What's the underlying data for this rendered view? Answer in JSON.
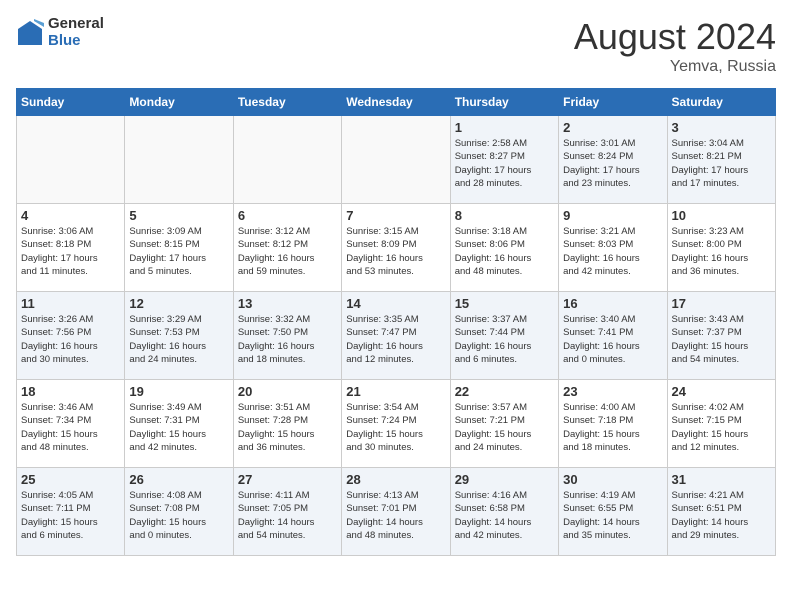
{
  "header": {
    "logo_general": "General",
    "logo_blue": "Blue",
    "month_year": "August 2024",
    "location": "Yemva, Russia"
  },
  "weekdays": [
    "Sunday",
    "Monday",
    "Tuesday",
    "Wednesday",
    "Thursday",
    "Friday",
    "Saturday"
  ],
  "weeks": [
    [
      {
        "day": "",
        "info": "",
        "empty": true
      },
      {
        "day": "",
        "info": "",
        "empty": true
      },
      {
        "day": "",
        "info": "",
        "empty": true
      },
      {
        "day": "",
        "info": "",
        "empty": true
      },
      {
        "day": "1",
        "info": "Sunrise: 2:58 AM\nSunset: 8:27 PM\nDaylight: 17 hours\nand 28 minutes."
      },
      {
        "day": "2",
        "info": "Sunrise: 3:01 AM\nSunset: 8:24 PM\nDaylight: 17 hours\nand 23 minutes."
      },
      {
        "day": "3",
        "info": "Sunrise: 3:04 AM\nSunset: 8:21 PM\nDaylight: 17 hours\nand 17 minutes."
      }
    ],
    [
      {
        "day": "4",
        "info": "Sunrise: 3:06 AM\nSunset: 8:18 PM\nDaylight: 17 hours\nand 11 minutes."
      },
      {
        "day": "5",
        "info": "Sunrise: 3:09 AM\nSunset: 8:15 PM\nDaylight: 17 hours\nand 5 minutes."
      },
      {
        "day": "6",
        "info": "Sunrise: 3:12 AM\nSunset: 8:12 PM\nDaylight: 16 hours\nand 59 minutes."
      },
      {
        "day": "7",
        "info": "Sunrise: 3:15 AM\nSunset: 8:09 PM\nDaylight: 16 hours\nand 53 minutes."
      },
      {
        "day": "8",
        "info": "Sunrise: 3:18 AM\nSunset: 8:06 PM\nDaylight: 16 hours\nand 48 minutes."
      },
      {
        "day": "9",
        "info": "Sunrise: 3:21 AM\nSunset: 8:03 PM\nDaylight: 16 hours\nand 42 minutes."
      },
      {
        "day": "10",
        "info": "Sunrise: 3:23 AM\nSunset: 8:00 PM\nDaylight: 16 hours\nand 36 minutes."
      }
    ],
    [
      {
        "day": "11",
        "info": "Sunrise: 3:26 AM\nSunset: 7:56 PM\nDaylight: 16 hours\nand 30 minutes."
      },
      {
        "day": "12",
        "info": "Sunrise: 3:29 AM\nSunset: 7:53 PM\nDaylight: 16 hours\nand 24 minutes."
      },
      {
        "day": "13",
        "info": "Sunrise: 3:32 AM\nSunset: 7:50 PM\nDaylight: 16 hours\nand 18 minutes."
      },
      {
        "day": "14",
        "info": "Sunrise: 3:35 AM\nSunset: 7:47 PM\nDaylight: 16 hours\nand 12 minutes."
      },
      {
        "day": "15",
        "info": "Sunrise: 3:37 AM\nSunset: 7:44 PM\nDaylight: 16 hours\nand 6 minutes."
      },
      {
        "day": "16",
        "info": "Sunrise: 3:40 AM\nSunset: 7:41 PM\nDaylight: 16 hours\nand 0 minutes."
      },
      {
        "day": "17",
        "info": "Sunrise: 3:43 AM\nSunset: 7:37 PM\nDaylight: 15 hours\nand 54 minutes."
      }
    ],
    [
      {
        "day": "18",
        "info": "Sunrise: 3:46 AM\nSunset: 7:34 PM\nDaylight: 15 hours\nand 48 minutes."
      },
      {
        "day": "19",
        "info": "Sunrise: 3:49 AM\nSunset: 7:31 PM\nDaylight: 15 hours\nand 42 minutes."
      },
      {
        "day": "20",
        "info": "Sunrise: 3:51 AM\nSunset: 7:28 PM\nDaylight: 15 hours\nand 36 minutes."
      },
      {
        "day": "21",
        "info": "Sunrise: 3:54 AM\nSunset: 7:24 PM\nDaylight: 15 hours\nand 30 minutes."
      },
      {
        "day": "22",
        "info": "Sunrise: 3:57 AM\nSunset: 7:21 PM\nDaylight: 15 hours\nand 24 minutes."
      },
      {
        "day": "23",
        "info": "Sunrise: 4:00 AM\nSunset: 7:18 PM\nDaylight: 15 hours\nand 18 minutes."
      },
      {
        "day": "24",
        "info": "Sunrise: 4:02 AM\nSunset: 7:15 PM\nDaylight: 15 hours\nand 12 minutes."
      }
    ],
    [
      {
        "day": "25",
        "info": "Sunrise: 4:05 AM\nSunset: 7:11 PM\nDaylight: 15 hours\nand 6 minutes."
      },
      {
        "day": "26",
        "info": "Sunrise: 4:08 AM\nSunset: 7:08 PM\nDaylight: 15 hours\nand 0 minutes."
      },
      {
        "day": "27",
        "info": "Sunrise: 4:11 AM\nSunset: 7:05 PM\nDaylight: 14 hours\nand 54 minutes."
      },
      {
        "day": "28",
        "info": "Sunrise: 4:13 AM\nSunset: 7:01 PM\nDaylight: 14 hours\nand 48 minutes."
      },
      {
        "day": "29",
        "info": "Sunrise: 4:16 AM\nSunset: 6:58 PM\nDaylight: 14 hours\nand 42 minutes."
      },
      {
        "day": "30",
        "info": "Sunrise: 4:19 AM\nSunset: 6:55 PM\nDaylight: 14 hours\nand 35 minutes."
      },
      {
        "day": "31",
        "info": "Sunrise: 4:21 AM\nSunset: 6:51 PM\nDaylight: 14 hours\nand 29 minutes."
      }
    ]
  ]
}
